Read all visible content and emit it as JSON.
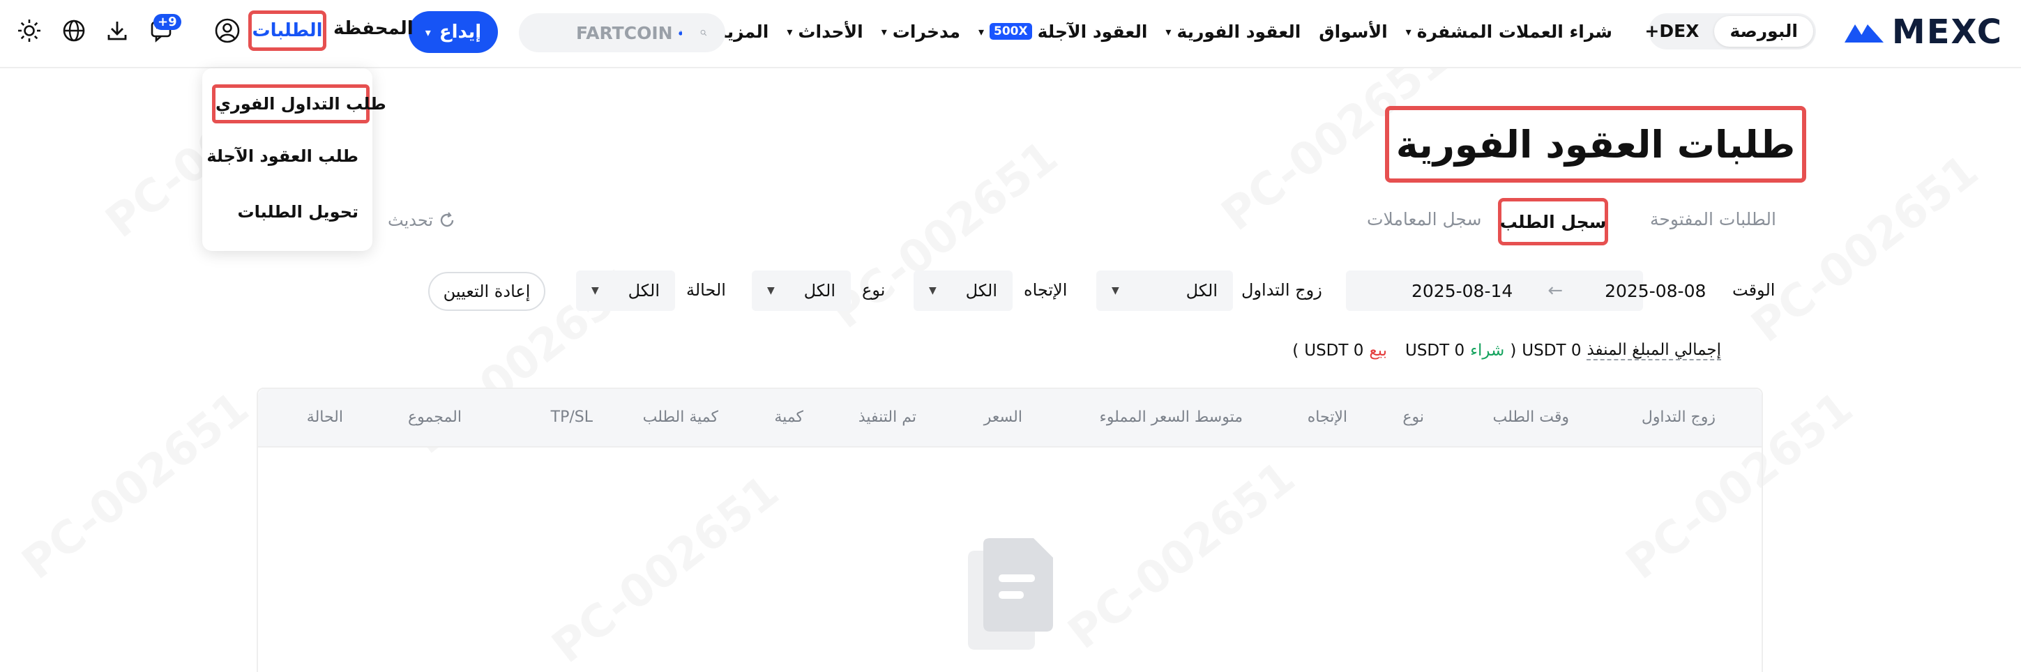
{
  "header": {
    "logo_text": "MEXC",
    "segments": [
      "البورصة",
      "DEX+"
    ],
    "nav": [
      {
        "label": "شراء العملات المشفرة",
        "has_caret": true
      },
      {
        "label": "الأسواق",
        "has_caret": false
      },
      {
        "label": "العقود الفورية",
        "has_caret": true
      },
      {
        "label": "العقود الآجلة",
        "has_caret": true,
        "badge": "500X"
      },
      {
        "label": "مدخرات",
        "has_caret": true
      },
      {
        "label": "الأحداث",
        "has_caret": true
      },
      {
        "label": "المزيد",
        "has_caret": true
      }
    ],
    "search_placeholder": "FARTCOIN",
    "deposit_label": "إيداع",
    "portfolio_label": "المحفظة",
    "orders_label": "الطلبات",
    "notif_count": "+9"
  },
  "dropdown": {
    "items": [
      "طلب التداول الفوري",
      "طلب العقود الآجلة",
      "تحويل الطلبات"
    ]
  },
  "page": {
    "title": "طلبات العقود الفورية",
    "tabs": [
      "الطلبات المفتوحة",
      "سجل الطلب",
      "سجل المعاملات"
    ],
    "refresh_label": "تحديث"
  },
  "filters": {
    "time_label": "الوقت",
    "date_from": "2025-08-08",
    "date_to": "2025-08-14",
    "pair_label": "زوج التداول",
    "pair_value": "الكل",
    "direction_label": "الإتجاه",
    "direction_value": "الكل",
    "type_label": "نوع",
    "type_value": "الكل",
    "status_label": "الحالة",
    "status_value": "الكل",
    "reset_label": "إعادة التعيين"
  },
  "totals": {
    "label": "إجمالي المبلغ المنفذ",
    "amount": "0 USDT",
    "open_paren": "(",
    "buy_label": "شراء",
    "buy_amount": "0 USDT",
    "sell_label": "بيع",
    "sell_amount": "0 USDT",
    "close_paren": ")"
  },
  "table": {
    "columns": [
      "زوج التداول",
      "وقت الطلب",
      "نوع",
      "الإتجاه",
      "متوسط السعر المملوء",
      "السعر",
      "تم التنفيذ",
      "كمية",
      "كمية الطلب",
      "TP/SL",
      "المجموع",
      "الحالة"
    ]
  },
  "colors": {
    "brand_blue": "#1754f5",
    "highlight_red": "#e65050",
    "buy_green": "#15a35e",
    "sell_red": "#e43c3c"
  }
}
